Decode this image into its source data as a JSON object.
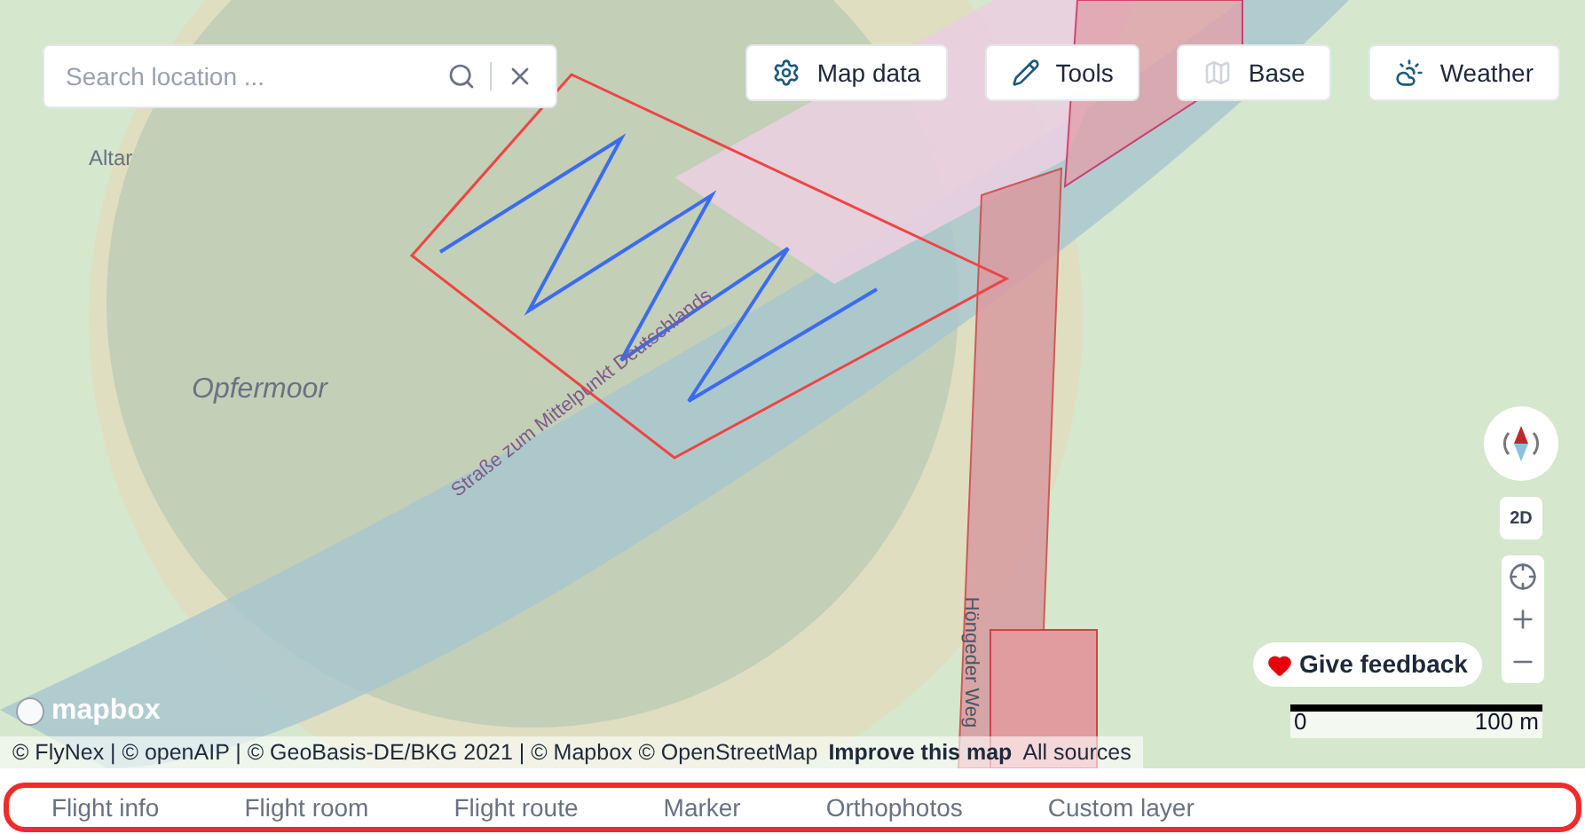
{
  "search": {
    "placeholder": "Search location ..."
  },
  "toolbar": [
    {
      "label": "Map data",
      "kind": "gear"
    },
    {
      "label": "Tools",
      "kind": "pencil"
    },
    {
      "label": "Base",
      "kind": "base"
    },
    {
      "label": "Weather",
      "kind": "weather"
    }
  ],
  "map_labels": [
    {
      "text": "Altar",
      "kind": "place"
    },
    {
      "text": "Opfermoor",
      "kind": "area"
    },
    {
      "text": "Straße zum Mittelpunkt Deutschlands",
      "kind": "road"
    },
    {
      "text": "Höngeder Weg",
      "kind": "street"
    }
  ],
  "map_controls": {
    "mode": "2D"
  },
  "feedback": {
    "label": "Give feedback"
  },
  "scale": {
    "start": "0",
    "end": "100 m"
  },
  "logo": "mapbox",
  "attribution": {
    "text": "© FlyNex | © openAIP | © GeoBasis-DE/BKG 2021 | © Mapbox © OpenStreetMap",
    "improve": "Improve this map",
    "sources": "All sources"
  },
  "tabs": [
    {
      "label": "Flight info",
      "selected": false
    },
    {
      "label": "Flight room",
      "selected": false
    },
    {
      "label": "Flight route",
      "selected": false
    },
    {
      "label": "Marker",
      "selected": false
    },
    {
      "label": "Orthophotos",
      "selected": false
    },
    {
      "label": "Custom layer",
      "selected": false
    }
  ]
}
